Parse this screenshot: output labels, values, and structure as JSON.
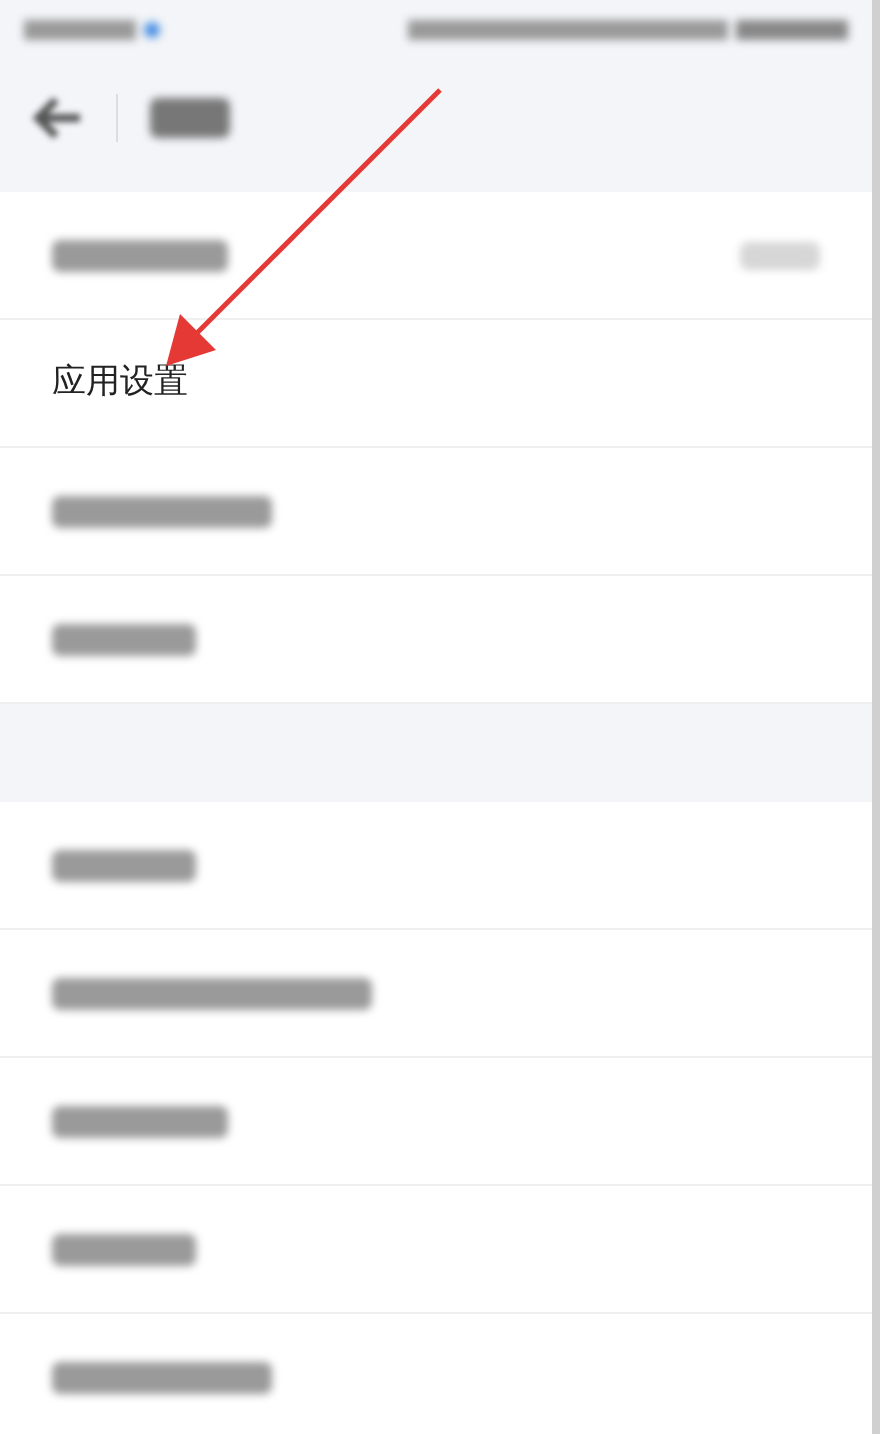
{
  "groups": [
    {
      "items": [
        {
          "kind": "redacted",
          "trailing": true
        },
        {
          "kind": "text",
          "label": "应用设置"
        },
        {
          "kind": "redacted",
          "trailing": false
        },
        {
          "kind": "redacted",
          "trailing": false
        }
      ]
    },
    {
      "items": [
        {
          "kind": "redacted",
          "trailing": false
        },
        {
          "kind": "redacted",
          "trailing": false
        },
        {
          "kind": "redacted",
          "trailing": false
        },
        {
          "kind": "redacted",
          "trailing": false
        },
        {
          "kind": "redacted",
          "trailing": false
        }
      ]
    }
  ]
}
